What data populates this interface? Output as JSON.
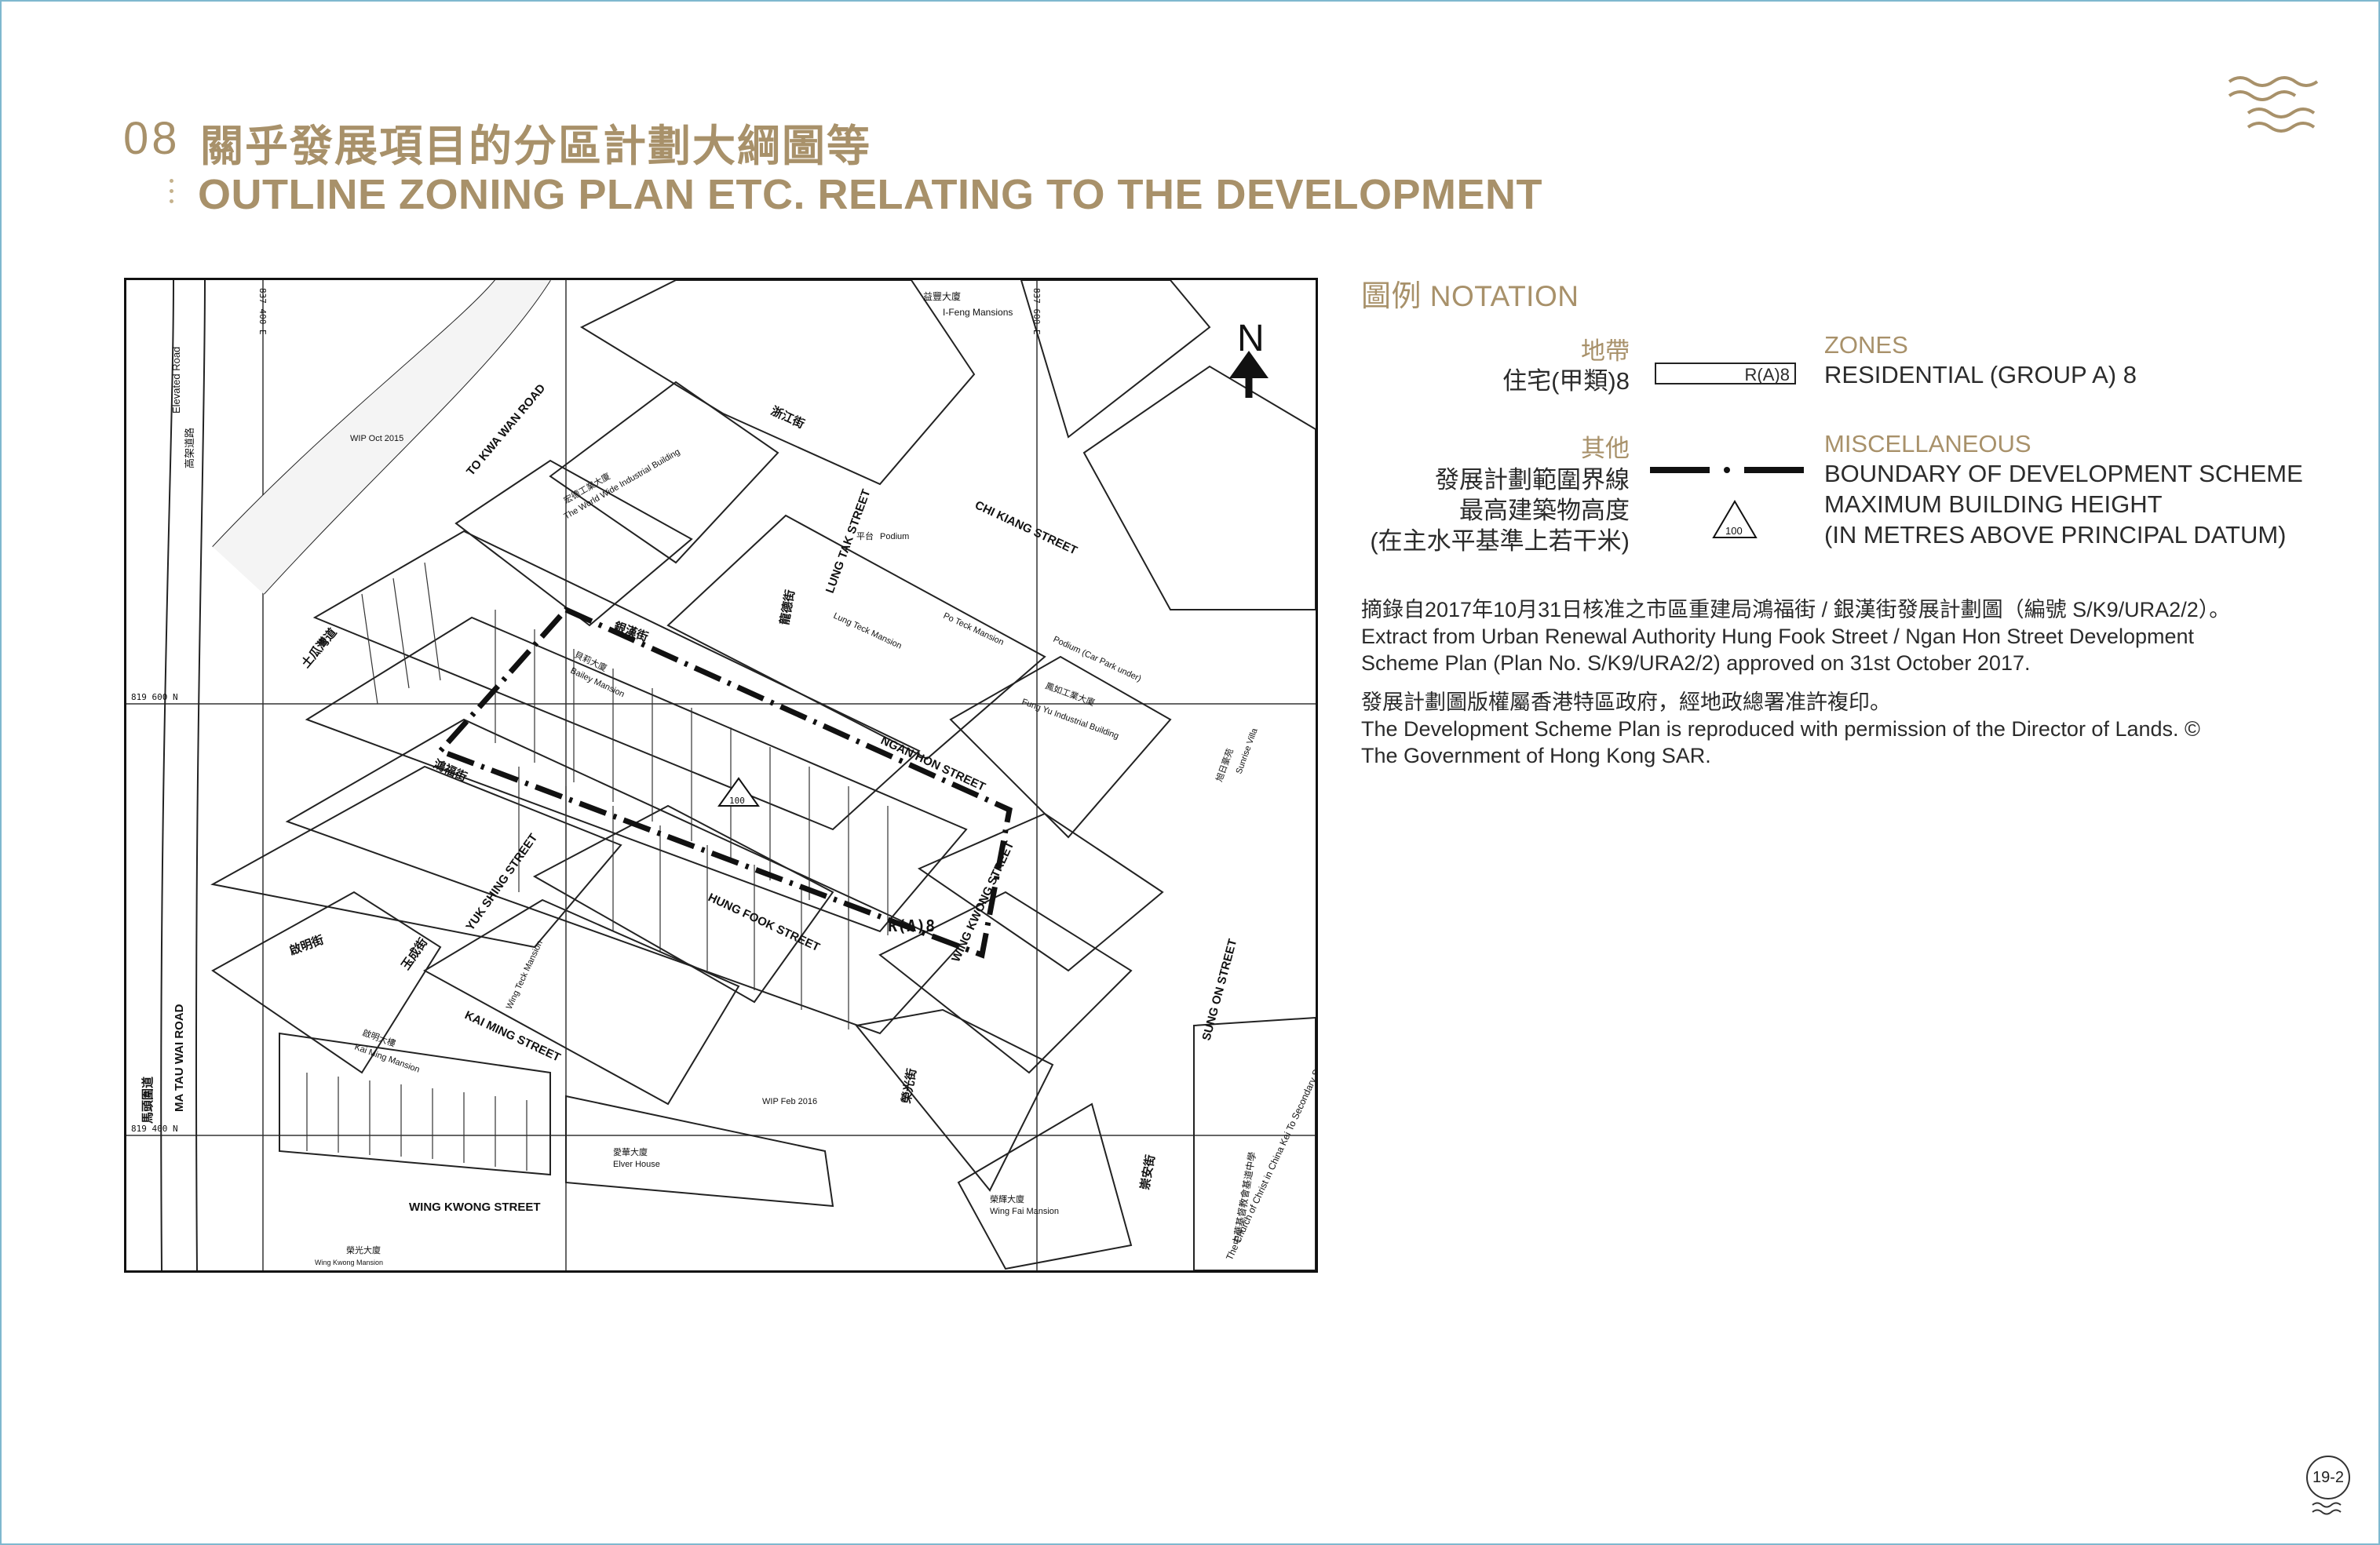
{
  "section": {
    "number": "08",
    "title_zh": "關乎發展項目的分區計劃大綱圖等",
    "title_en": "OUTLINE ZONING PLAN ETC. RELATING TO THE DEVELOPMENT"
  },
  "map": {
    "north_label": "N",
    "grid_labels": [
      "837 400 E",
      "837 600 E",
      "819 600 N",
      "819 400 N"
    ],
    "labels": {
      "elevated_road": "Elevated Road",
      "elevated_road_zh": "高架道路",
      "wip_2015": "WIP Oct 2015",
      "wip_2016": "WIP Feb 2016",
      "to_kwa_wan_road": "TO KWA WAN ROAD",
      "to_kwa_wan_road_zh": "土瓜灣道",
      "chi_kiang_street": "CHI KIANG STREET",
      "chi_kiang_street_zh": "浙江街",
      "lung_tak_street": "LUNG TAK STREET",
      "lung_tak_street_zh": "龍德街",
      "ngan_hon_street": "NGAN HON STREET",
      "ngan_hon_street_zh": "銀漢街",
      "hung_fook_street": "HUNG FOOK STREET",
      "hung_fook_street_zh": "鴻福街",
      "yuk_shing_street": "YUK SHING STREET",
      "yuk_shing_street_zh": "玉成街",
      "kai_ming_street": "KAI MING STREET",
      "kai_ming_street_zh": "啟明街",
      "wing_kwong_street": "WING KWONG STREET",
      "wing_kwong_street_zh": "榮光街",
      "sung_on_street": "SUNG ON STREET",
      "sung_on_street_zh": "崇安街",
      "ma_tau_wai_road": "MA TAU WAI ROAD",
      "ma_tau_wai_road_zh": "馬頭圍道",
      "i_feng_mansions": "I-Feng Mansions",
      "i_feng_mansions_zh": "益豐大廈",
      "world_wide": "The World Wide Industrial Building",
      "world_wide_zh": "宏德工業大廈",
      "fung_yu": "Fung Yu Industrial Building",
      "fung_yu_zh": "鳳如工業大廈",
      "bailey_mansion": "Bailey Mansion",
      "bailey_mansion_zh": "貝莉大廈",
      "po_teck_mansion": "Po Teck Mansion",
      "lung_teck_mansion": "Lung Teck Mansion",
      "wing_teck_mansion": "Wing Teck Mansion",
      "kai_ming_mansion": "Kai Ming Mansion",
      "kai_ming_mansion_zh": "啟明大樓",
      "elver_house": "Elver House",
      "elver_house_zh": "愛華大廈",
      "wing_fai_mansion": "Wing Fai Mansion",
      "wing_fai_mansion_zh": "榮輝大廈",
      "wing_kwong_mansion": "Wing Kwong Mansion",
      "wing_kwong_mansion_zh": "榮光大廈",
      "sunrise_villa": "Sunrise Villa",
      "sunrise_villa_zh": "旭日豪苑",
      "school": "The Church of Christ in China Kei To Secondary School",
      "school_zh": "中華基督教會基道中學",
      "podium": "Podium",
      "podium_zh": "平台",
      "podium_car_park": "Podium (Car Park under)",
      "zone_label": "R(A)8",
      "height_label": "100"
    }
  },
  "notation": {
    "heading_zh": "圖例",
    "heading_en": "NOTATION",
    "zones_zh": "地帶",
    "zones_en": "ZONES",
    "residential_zh": "住宅(甲類)8",
    "residential_en": "RESIDENTIAL (GROUP A) 8",
    "residential_symbol": "R(A)8",
    "misc_zh": "其他",
    "misc_en": "MISCELLANEOUS",
    "boundary_zh": "發展計劃範圍界線",
    "boundary_en": "BOUNDARY OF DEVELOPMENT SCHEME",
    "height_zh": "最高建築物高度",
    "height_en": "MAXIMUM BUILDING HEIGHT",
    "datum_zh": "(在主水平基準上若干米)",
    "datum_en": "(IN METRES ABOVE PRINCIPAL DATUM)",
    "height_symbol": "100"
  },
  "notes": {
    "extract_zh": "摘錄自2017年10月31日核准之市區重建局鴻福街 / 銀漢街發展計劃圖（編號 S/K9/URA2/2）。",
    "extract_en_1": "Extract from Urban Renewal Authority Hung Fook Street / Ngan Hon Street Development",
    "extract_en_2": "Scheme Plan (Plan No. S/K9/URA2/2) approved on 31st October 2017.",
    "copyright_zh": "發展計劃圖版權屬香港特區政府，經地政總署准許複印。",
    "copyright_en_1": "The Development Scheme Plan is reproduced with permission of the Director of Lands. ©",
    "copyright_en_2": "The Government of Hong Kong SAR."
  },
  "page": {
    "number": "19-2"
  },
  "colors": {
    "accent_gold": "#a8916a",
    "frame_blue": "#7fb8cf"
  }
}
